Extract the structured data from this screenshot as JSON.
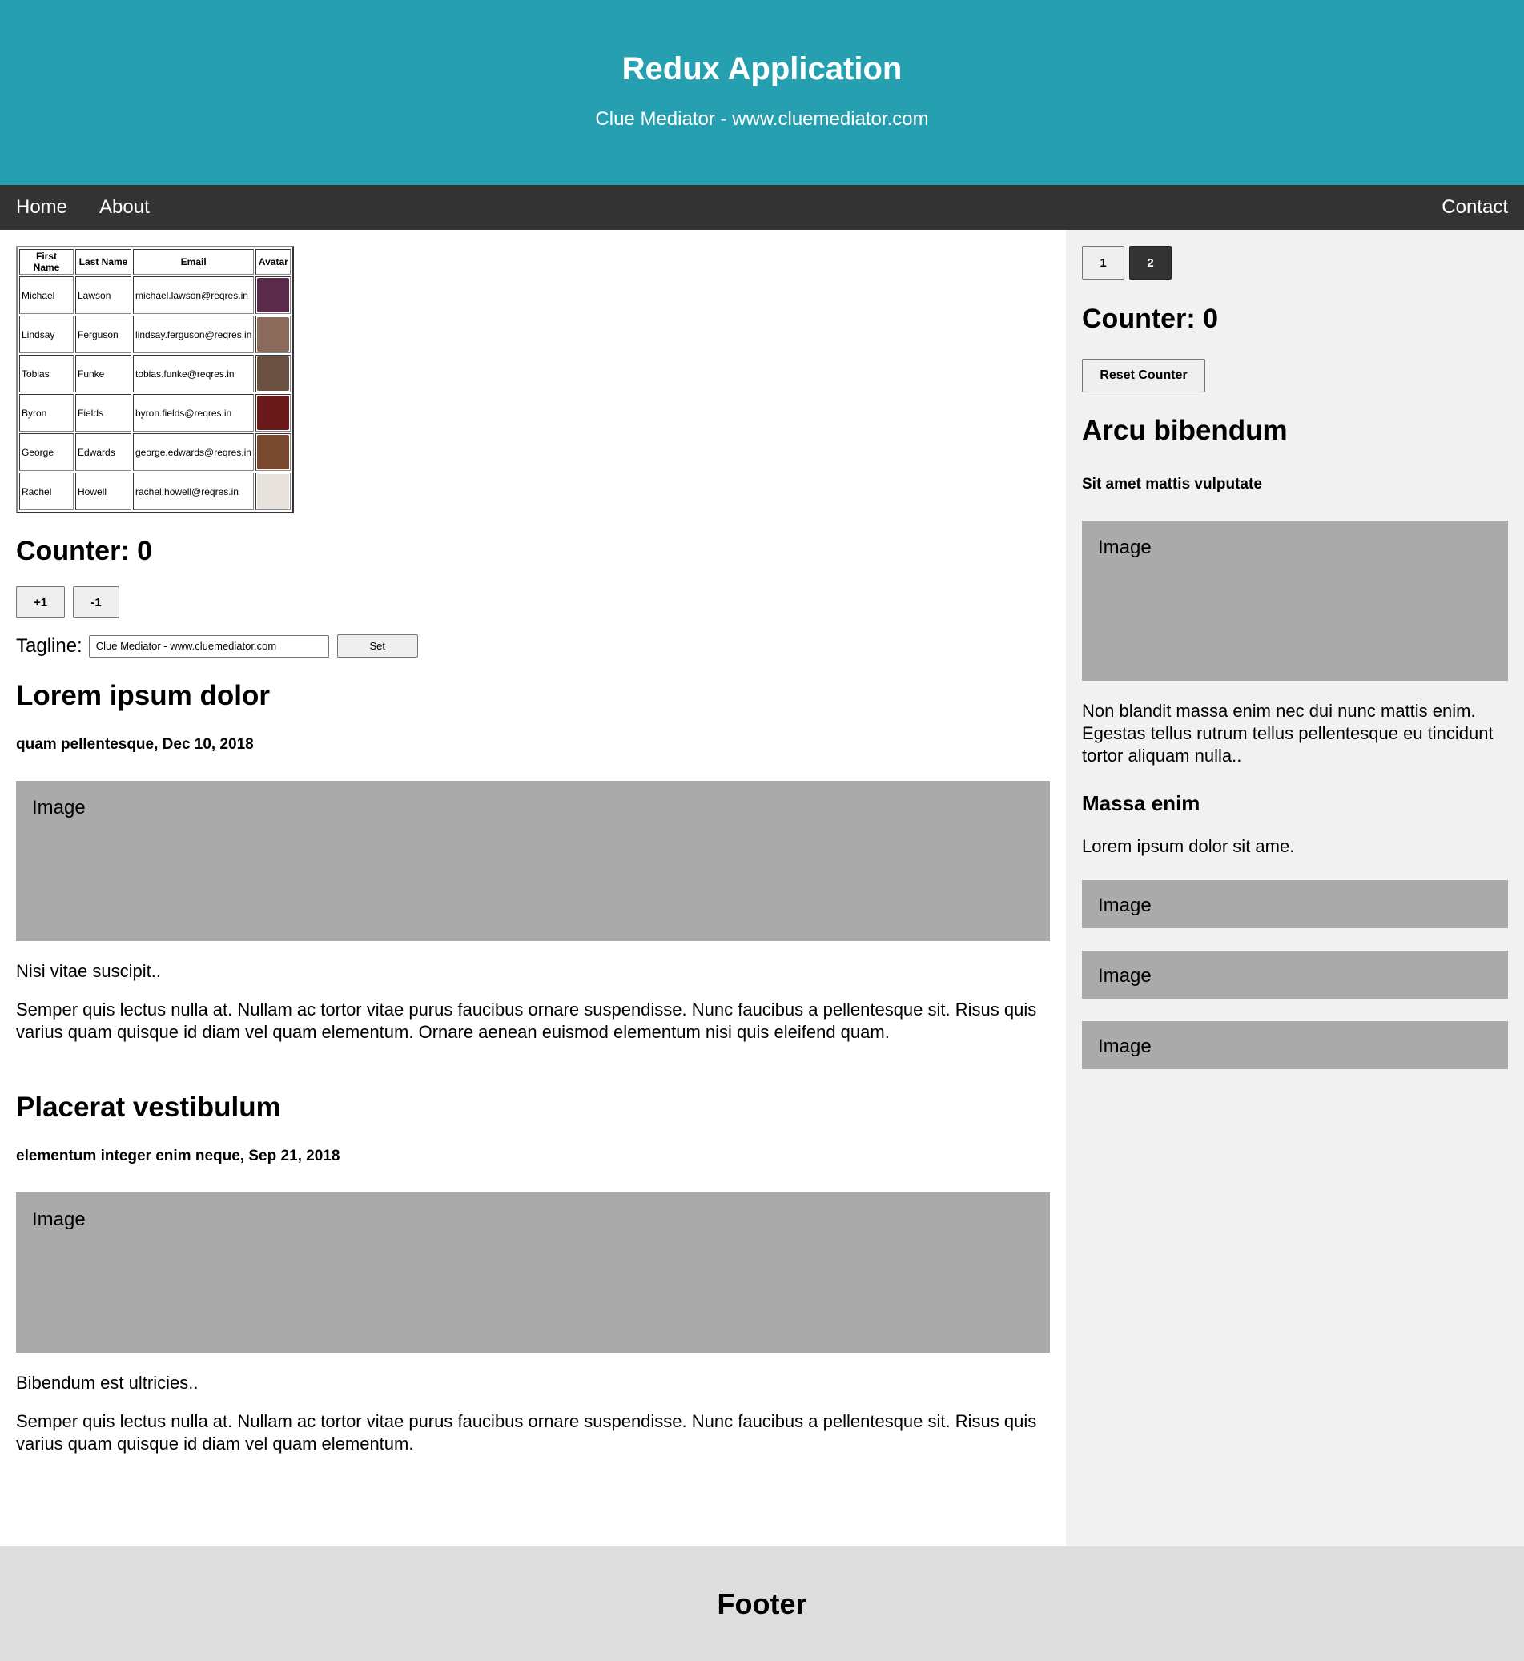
{
  "header": {
    "title": "Redux Application",
    "tagline": "Clue Mediator - www.cluemediator.com"
  },
  "nav": {
    "home": "Home",
    "about": "About",
    "contact": "Contact"
  },
  "colors": {
    "header_bg": "#26a0b0",
    "nav_bg": "#333333",
    "sidebar_bg": "#f1f1f1",
    "image_placeholder": "#aaaaaa",
    "footer_bg": "#dddddd"
  },
  "users_table": {
    "columns": [
      "First Name",
      "Last Name",
      "Email",
      "Avatar"
    ],
    "rows": [
      {
        "first": "Michael",
        "last": "Lawson",
        "email": "michael.lawson@reqres.in",
        "avatar_color": "#5a2a4a"
      },
      {
        "first": "Lindsay",
        "last": "Ferguson",
        "email": "lindsay.ferguson@reqres.in",
        "avatar_color": "#8a6a5a"
      },
      {
        "first": "Tobias",
        "last": "Funke",
        "email": "tobias.funke@reqres.in",
        "avatar_color": "#6a5040"
      },
      {
        "first": "Byron",
        "last": "Fields",
        "email": "byron.fields@reqres.in",
        "avatar_color": "#6a1a1a"
      },
      {
        "first": "George",
        "last": "Edwards",
        "email": "george.edwards@reqres.in",
        "avatar_color": "#7a4a30"
      },
      {
        "first": "Rachel",
        "last": "Howell",
        "email": "rachel.howell@reqres.in",
        "avatar_color": "#e8e2dc"
      }
    ]
  },
  "main_counter": {
    "label": "Counter: 0",
    "plus_label": "+1",
    "minus_label": "-1"
  },
  "tagline_form": {
    "label": "Tagline:",
    "value": "Clue Mediator - www.cluemediator.com",
    "set_label": "Set"
  },
  "posts": [
    {
      "title": "Lorem ipsum dolor",
      "meta": "quam pellentesque, Dec 10, 2018",
      "image_label": "Image",
      "summary": "Nisi vitae suscipit..",
      "body": "Semper quis lectus nulla at. Nullam ac tortor vitae purus faucibus ornare suspendisse. Nunc faucibus a pellentesque sit. Risus quis varius quam quisque id diam vel quam elementum. Ornare aenean euismod elementum nisi quis eleifend quam."
    },
    {
      "title": "Placerat vestibulum",
      "meta": "elementum integer enim neque, Sep 21, 2018",
      "image_label": "Image",
      "summary": "Bibendum est ultricies..",
      "body": "Semper quis lectus nulla at. Nullam ac tortor vitae purus faucibus ornare suspendisse. Nunc faucibus a pellentesque sit. Risus quis varius quam quisque id diam vel quam elementum."
    }
  ],
  "sidebar": {
    "pages": [
      "1",
      "2"
    ],
    "active_page": "2",
    "counter_label": "Counter: 0",
    "reset_label": "Reset Counter",
    "title": "Arcu bibendum",
    "subtitle": "Sit amet mattis vulputate",
    "image_label": "Image",
    "description": "Non blandit massa enim nec dui nunc mattis enim. Egestas tellus rutrum tellus pellentesque eu tincidunt tortor aliquam nulla..",
    "section_title": "Massa enim",
    "section_text": "Lorem ipsum dolor sit ame.",
    "small_images": [
      "Image",
      "Image",
      "Image"
    ]
  },
  "footer": {
    "text": "Footer"
  }
}
